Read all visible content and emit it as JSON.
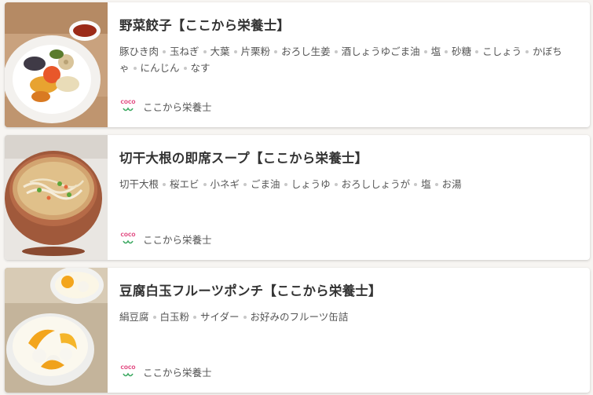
{
  "colors": {
    "title": "#333333",
    "text": "#555555",
    "separator_dot": "#c8c8c8",
    "logo_pink": "#e0407a",
    "logo_green": "#3aa860"
  },
  "recipes": [
    {
      "title": "野菜餃子【ここから栄養士】",
      "ingredients": [
        "豚ひき肉",
        "玉ねぎ",
        "大葉",
        "片栗粉",
        "おろし生姜",
        "酒しょうゆごま油",
        "塩",
        "砂糖",
        "こしょう",
        "かぼちゃ",
        "にんじん",
        "なす"
      ],
      "author": "ここから栄養士",
      "author_logo_text": "COCO"
    },
    {
      "title": "切干大根の即席スープ【ここから栄養士】",
      "ingredients": [
        "切干大根",
        "桜エビ",
        "小ネギ",
        "ごま油",
        "しょうゆ",
        "おろししょうが",
        "塩",
        "お湯"
      ],
      "author": "ここから栄養士",
      "author_logo_text": "COCO"
    },
    {
      "title": "豆腐白玉フルーツポンチ【ここから栄養士】",
      "ingredients": [
        "絹豆腐",
        "白玉粉",
        "サイダー",
        "お好みのフルーツ缶詰"
      ],
      "author": "ここから栄養士",
      "author_logo_text": "COCO"
    }
  ]
}
